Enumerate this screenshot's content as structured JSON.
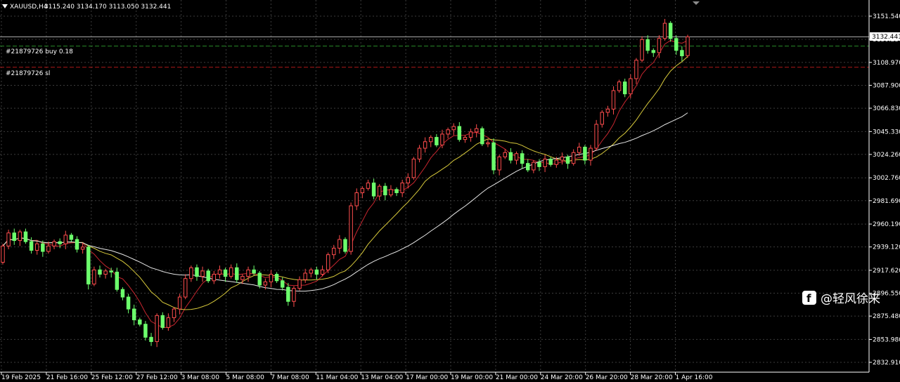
{
  "header": {
    "symbol": "XAUUSD,H4",
    "ohlc": "3115.240 3134.170 3113.050 3132.441"
  },
  "order_labels": {
    "buy": "#21879726 buy 0.18",
    "sl": "#21879726 sl"
  },
  "current_price": "3132.441",
  "watermark": "@轻风徐来",
  "colors": {
    "background": "#000000",
    "grid": "#3c3c3c",
    "bull": "#ff4d4d",
    "bear": "#6cff6c",
    "ma_fast": "#c8262f",
    "ma_mid": "#d7c93b",
    "ma_slow": "#e6e6e6",
    "buy_line": "#2a8a2a",
    "sl_line": "#b01818"
  },
  "chart_data": {
    "type": "candlestick",
    "y_ticks": [
      "3151.540",
      "3130.250",
      "3108.970",
      "3087.900",
      "3066.830",
      "3045.330",
      "3024.260",
      "3002.760",
      "2981.690",
      "2960.190",
      "2939.120",
      "2917.620",
      "2896.550",
      "2875.480",
      "2853.980",
      "2832.910"
    ],
    "ylim": [
      2832.91,
      3151.54
    ],
    "x_ticks": [
      "19 Feb 2025",
      "21 Feb 16:00",
      "25 Feb 12:00",
      "27 Feb 12:00",
      "3 Mar 08:00",
      "5 Mar 08:00",
      "7 Mar 08:00",
      "11 Mar 04:00",
      "13 Mar 04:00",
      "17 Mar 00:00",
      "19 Mar 00:00",
      "21 Mar 00:00",
      "24 Mar 20:00",
      "26 Mar 20:00",
      "28 Mar 20:00",
      "1 Apr 16:00"
    ],
    "current_price": 3132.441,
    "buy_level": 3124.0,
    "sl_level": 3104.5,
    "candles": [
      {
        "o": 2925,
        "c": 2940
      },
      {
        "o": 2940,
        "c": 2952
      },
      {
        "o": 2952,
        "c": 2945
      },
      {
        "o": 2945,
        "c": 2953
      },
      {
        "o": 2953,
        "c": 2944
      },
      {
        "o": 2944,
        "c": 2936
      },
      {
        "o": 2936,
        "c": 2942
      },
      {
        "o": 2942,
        "c": 2935
      },
      {
        "o": 2935,
        "c": 2940
      },
      {
        "o": 2940,
        "c": 2944
      },
      {
        "o": 2944,
        "c": 2942
      },
      {
        "o": 2942,
        "c": 2950
      },
      {
        "o": 2950,
        "c": 2946
      },
      {
        "o": 2946,
        "c": 2937
      },
      {
        "o": 2937,
        "c": 2939
      },
      {
        "o": 2939,
        "c": 2905
      },
      {
        "o": 2905,
        "c": 2918
      },
      {
        "o": 2918,
        "c": 2914
      },
      {
        "o": 2914,
        "c": 2917
      },
      {
        "o": 2917,
        "c": 2916
      },
      {
        "o": 2916,
        "c": 2900
      },
      {
        "o": 2900,
        "c": 2893
      },
      {
        "o": 2893,
        "c": 2882
      },
      {
        "o": 2882,
        "c": 2872
      },
      {
        "o": 2872,
        "c": 2868
      },
      {
        "o": 2868,
        "c": 2856
      },
      {
        "o": 2856,
        "c": 2852
      },
      {
        "o": 2852,
        "c": 2876
      },
      {
        "o": 2876,
        "c": 2865
      },
      {
        "o": 2865,
        "c": 2874
      },
      {
        "o": 2874,
        "c": 2882
      },
      {
        "o": 2882,
        "c": 2893
      },
      {
        "o": 2893,
        "c": 2910
      },
      {
        "o": 2910,
        "c": 2920
      },
      {
        "o": 2920,
        "c": 2912
      },
      {
        "o": 2912,
        "c": 2917
      },
      {
        "o": 2917,
        "c": 2908
      },
      {
        "o": 2908,
        "c": 2914
      },
      {
        "o": 2914,
        "c": 2918
      },
      {
        "o": 2918,
        "c": 2912
      },
      {
        "o": 2912,
        "c": 2920
      },
      {
        "o": 2920,
        "c": 2909
      },
      {
        "o": 2909,
        "c": 2912
      },
      {
        "o": 2912,
        "c": 2918
      },
      {
        "o": 2918,
        "c": 2915
      },
      {
        "o": 2915,
        "c": 2904
      },
      {
        "o": 2904,
        "c": 2907
      },
      {
        "o": 2907,
        "c": 2914
      },
      {
        "o": 2914,
        "c": 2908
      },
      {
        "o": 2908,
        "c": 2902
      },
      {
        "o": 2902,
        "c": 2889
      },
      {
        "o": 2889,
        "c": 2901
      },
      {
        "o": 2901,
        "c": 2909
      },
      {
        "o": 2909,
        "c": 2915
      },
      {
        "o": 2915,
        "c": 2918
      },
      {
        "o": 2918,
        "c": 2914
      },
      {
        "o": 2914,
        "c": 2918
      },
      {
        "o": 2918,
        "c": 2932
      },
      {
        "o": 2932,
        "c": 2938
      },
      {
        "o": 2938,
        "c": 2946
      },
      {
        "o": 2946,
        "c": 2935
      },
      {
        "o": 2935,
        "c": 2977
      },
      {
        "o": 2977,
        "c": 2989
      },
      {
        "o": 2989,
        "c": 2993
      },
      {
        "o": 2993,
        "c": 2998
      },
      {
        "o": 2998,
        "c": 2986
      },
      {
        "o": 2986,
        "c": 2995
      },
      {
        "o": 2995,
        "c": 2987
      },
      {
        "o": 2987,
        "c": 2992
      },
      {
        "o": 2992,
        "c": 2989
      },
      {
        "o": 2989,
        "c": 2998
      },
      {
        "o": 2998,
        "c": 3003
      },
      {
        "o": 3003,
        "c": 3020
      },
      {
        "o": 3020,
        "c": 3030
      },
      {
        "o": 3030,
        "c": 3036
      },
      {
        "o": 3036,
        "c": 3040
      },
      {
        "o": 3040,
        "c": 3033
      },
      {
        "o": 3033,
        "c": 3043
      },
      {
        "o": 3043,
        "c": 3047
      },
      {
        "o": 3047,
        "c": 3050
      },
      {
        "o": 3050,
        "c": 3038
      },
      {
        "o": 3038,
        "c": 3040
      },
      {
        "o": 3040,
        "c": 3045
      },
      {
        "o": 3045,
        "c": 3048
      },
      {
        "o": 3048,
        "c": 3034
      },
      {
        "o": 3034,
        "c": 3035
      },
      {
        "o": 3035,
        "c": 3010
      },
      {
        "o": 3010,
        "c": 3022
      },
      {
        "o": 3022,
        "c": 3026
      },
      {
        "o": 3026,
        "c": 3019
      },
      {
        "o": 3019,
        "c": 3025
      },
      {
        "o": 3025,
        "c": 3016
      },
      {
        "o": 3016,
        "c": 3010
      },
      {
        "o": 3010,
        "c": 3017
      },
      {
        "o": 3017,
        "c": 3013
      },
      {
        "o": 3013,
        "c": 3020
      },
      {
        "o": 3020,
        "c": 3015
      },
      {
        "o": 3015,
        "c": 3019
      },
      {
        "o": 3019,
        "c": 3022
      },
      {
        "o": 3022,
        "c": 3016
      },
      {
        "o": 3016,
        "c": 3026
      },
      {
        "o": 3026,
        "c": 3031
      },
      {
        "o": 3031,
        "c": 3019
      },
      {
        "o": 3019,
        "c": 3030
      },
      {
        "o": 3030,
        "c": 3052
      },
      {
        "o": 3052,
        "c": 3063
      },
      {
        "o": 3063,
        "c": 3066
      },
      {
        "o": 3066,
        "c": 3083
      },
      {
        "o": 3083,
        "c": 3091
      },
      {
        "o": 3091,
        "c": 3080
      },
      {
        "o": 3080,
        "c": 3094
      },
      {
        "o": 3094,
        "c": 3111
      },
      {
        "o": 3111,
        "c": 3130
      },
      {
        "o": 3130,
        "c": 3120
      },
      {
        "o": 3120,
        "c": 3118
      },
      {
        "o": 3118,
        "c": 3131
      },
      {
        "o": 3131,
        "c": 3145
      },
      {
        "o": 3145,
        "c": 3131
      },
      {
        "o": 3131,
        "c": 3120
      },
      {
        "o": 3120,
        "c": 3115
      },
      {
        "o": 3115.24,
        "c": 3132.441
      }
    ]
  }
}
